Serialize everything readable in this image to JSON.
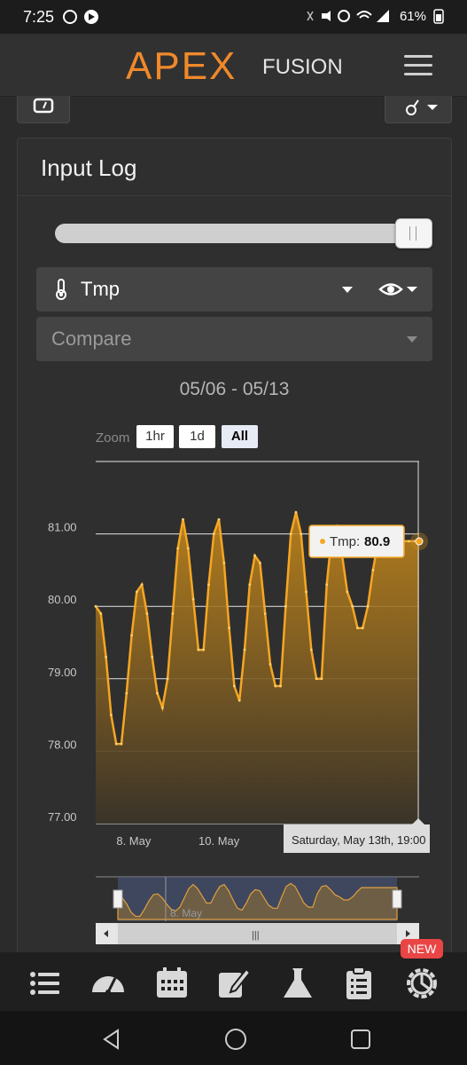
{
  "status_bar": {
    "time": "7:25",
    "battery": "61%"
  },
  "header": {
    "logo_main": "APEX",
    "logo_sub": "FUSION"
  },
  "panel": {
    "title": "Input Log",
    "input_select": {
      "value": "Tmp"
    },
    "compare_select": {
      "placeholder": "Compare"
    },
    "date_range": "05/06 - 05/13",
    "zoom": {
      "label": "Zoom",
      "options": [
        "1hr",
        "1d",
        "All"
      ],
      "active": "All"
    }
  },
  "chart_data": {
    "type": "area",
    "series": [
      {
        "name": "Tmp",
        "x_hours": [
          0,
          3,
          6,
          9,
          12,
          15,
          18,
          21,
          24,
          27,
          30,
          33,
          36,
          39,
          42,
          45,
          48,
          51,
          54,
          57,
          60,
          63,
          66,
          69,
          72,
          75,
          78,
          81,
          84,
          87,
          90,
          93,
          96,
          99,
          102,
          105,
          108,
          111,
          114,
          117,
          120,
          123,
          126,
          129,
          132,
          135,
          138,
          141,
          144,
          147,
          150,
          153,
          156,
          159,
          162,
          165,
          168,
          171,
          174,
          177,
          180,
          183,
          186,
          189
        ],
        "values": [
          80.0,
          79.9,
          79.3,
          78.5,
          78.1,
          78.1,
          78.8,
          79.6,
          80.2,
          80.3,
          79.9,
          79.3,
          78.8,
          78.6,
          79.0,
          79.9,
          80.8,
          81.2,
          80.8,
          80.1,
          79.4,
          79.4,
          80.3,
          81.0,
          81.2,
          80.6,
          79.7,
          78.9,
          78.7,
          79.4,
          80.3,
          80.7,
          80.6,
          79.9,
          79.2,
          78.9,
          78.9,
          80.0,
          81.0,
          81.3,
          81.0,
          80.2,
          79.4,
          79.0,
          79.0,
          80.3,
          81.0,
          81.1,
          80.7,
          80.2,
          80.0,
          79.7,
          79.7,
          80.0,
          80.5,
          80.9,
          80.9,
          80.9,
          80.9,
          80.9,
          80.9,
          80.9,
          80.9,
          80.9
        ],
        "color": "#f5a623"
      }
    ],
    "y_ticks": [
      "81.00",
      "80.00",
      "79.00",
      "78.00",
      "77.00"
    ],
    "x_ticks": [
      "8. May",
      "10. May"
    ],
    "ylim": [
      77,
      82
    ],
    "tooltip": {
      "label": "Tmp:",
      "value": "80.9"
    },
    "crosshair_label": "Saturday, May 13th, 19:00",
    "navigator_label": "8. May"
  },
  "bottom_nav": {
    "items": [
      "list-icon",
      "dashboard-icon",
      "calendar-icon",
      "edit-icon",
      "flask-icon",
      "clipboard-icon",
      "settings-icon"
    ],
    "badge": "NEW"
  },
  "colors": {
    "accent": "#f5a623",
    "brand": "#f0892a"
  }
}
